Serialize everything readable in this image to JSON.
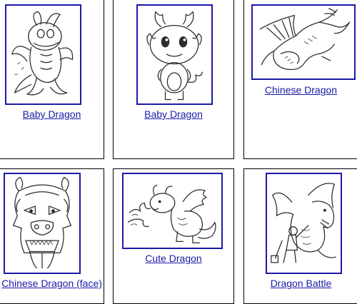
{
  "gallery": {
    "items": [
      {
        "label": "Baby Dragon",
        "icon": "baby-dragon-sketch"
      },
      {
        "label": "Baby Dragon",
        "icon": "cute-baby-dragon-cartoon"
      },
      {
        "label": "Chinese Dragon",
        "icon": "flying-chinese-dragon"
      },
      {
        "label": "Chinese Dragon (face)",
        "icon": "chinese-dragon-mask"
      },
      {
        "label": "Cute Dragon",
        "icon": "fire-breathing-dragon"
      },
      {
        "label": "Dragon Battle",
        "icon": "knight-vs-dragon"
      }
    ]
  },
  "colors": {
    "link": "#1a1aa8",
    "thumb_border": "#1a1aa8",
    "cell_border": "#000000",
    "line_art": "#2b2b2b"
  }
}
